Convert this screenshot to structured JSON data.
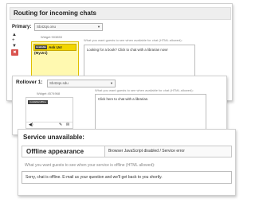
{
  "routing": {
    "title": "Routing for incoming chats",
    "primary_label": "Primary:",
    "primary_select": "Sb42qs.onu",
    "widget_id": "Widget 903853",
    "hint": "What you want guests to see when available for chat (HTML allowed):",
    "chat_badge": "Available",
    "chat_name": "Ask Us! (MyUni)",
    "message": "Looking for a book? Click to chat with a librarian now!",
    "controls": {
      "up": "▲",
      "plus": "+",
      "down": "▼",
      "delete": "✖"
    }
  },
  "rollover": {
    "label": "Rollover 1:",
    "select": "Sb42qs.sdu",
    "widget_id": "Widget 4574968",
    "hint": "What you want guests to see when available for chat (HTML allowed):",
    "tag": "Available/offline",
    "message": "Click here to chat with a librarian."
  },
  "service": {
    "title": "Service unavailable:",
    "tab": "Offline appearance",
    "tab_description": "Browser JavaScript disabled / Service error",
    "hint": "What you want guests to see when your service is offline (HTML allowed):",
    "message": "Sorry, chat is offline. E-mail us your question and we'll get back to you shortly."
  },
  "icons": [
    "sound-icon",
    "edit-icon",
    "mail-icon",
    "chevron-down-icon"
  ],
  "colors": {
    "chat_header": "#f2d600",
    "chat_box": "#fff9b0",
    "delete_button": "#d9534f"
  }
}
